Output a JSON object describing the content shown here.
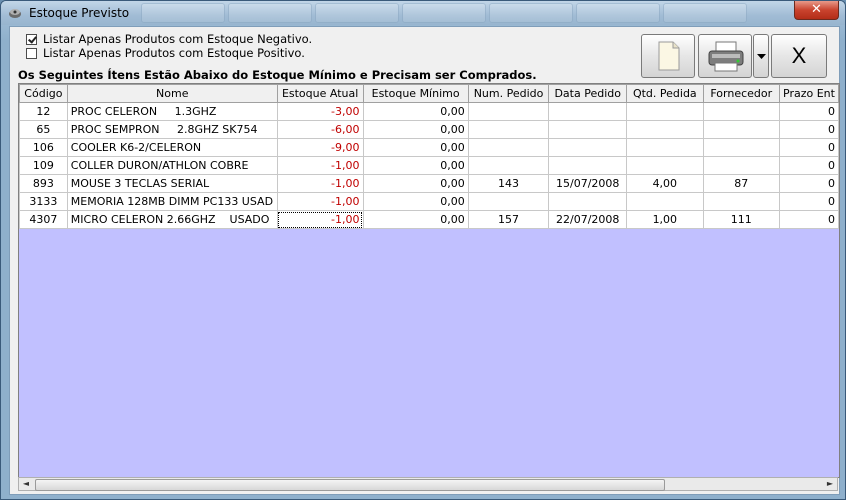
{
  "window": {
    "title": "Estoque Previsto",
    "close_label": "✕"
  },
  "options": {
    "negative_label": "Listar Apenas Produtos com Estoque Negativo.",
    "negative_checked": true,
    "positive_label": "Listar Apenas Produtos com Estoque Positivo.",
    "positive_checked": false
  },
  "toolbar": {
    "new_icon": "document-icon",
    "print_icon": "printer-icon",
    "dropdown_icon": "chevron-down-icon",
    "close_label": "X"
  },
  "info_text": "Os Seguintes Ítens Estão Abaixo do Estoque Mínimo e Precisam ser Comprados.",
  "table": {
    "columns": [
      "Código",
      "Nome",
      "Estoque Atual",
      "Estoque Mínimo",
      "Num. Pedido",
      "Data Pedido",
      "Qtd. Pedida",
      "Fornecedor",
      "Prazo Ent"
    ],
    "rows": [
      [
        "12",
        "PROC CELERON     1.3GHZ",
        "-3,00",
        "0,00",
        "",
        "",
        "",
        "",
        "0"
      ],
      [
        "65",
        "PROC SEMPRON     2.8GHZ SK754",
        "-6,00",
        "0,00",
        "",
        "",
        "",
        "",
        "0"
      ],
      [
        "106",
        "COOLER K6-2/CELERON",
        "-9,00",
        "0,00",
        "",
        "",
        "",
        "",
        "0"
      ],
      [
        "109",
        "COLLER DURON/ATHLON COBRE",
        "-1,00",
        "0,00",
        "",
        "",
        "",
        "",
        "0"
      ],
      [
        "893",
        "MOUSE 3 TECLAS SERIAL",
        "-1,00",
        "0,00",
        "143",
        "15/07/2008",
        "4,00",
        "87",
        "0"
      ],
      [
        "3133",
        "MEMORIA 128MB DIMM PC133 USAD",
        "-1,00",
        "0,00",
        "",
        "",
        "",
        "",
        "0"
      ],
      [
        "4307",
        "MICRO CELERON 2.66GHZ    USADO",
        "-1,00",
        "0,00",
        "157",
        "22/07/2008",
        "1,00",
        "111",
        "0"
      ]
    ]
  },
  "scrollbar": {
    "left_arrow": "◄",
    "right_arrow": "►"
  }
}
